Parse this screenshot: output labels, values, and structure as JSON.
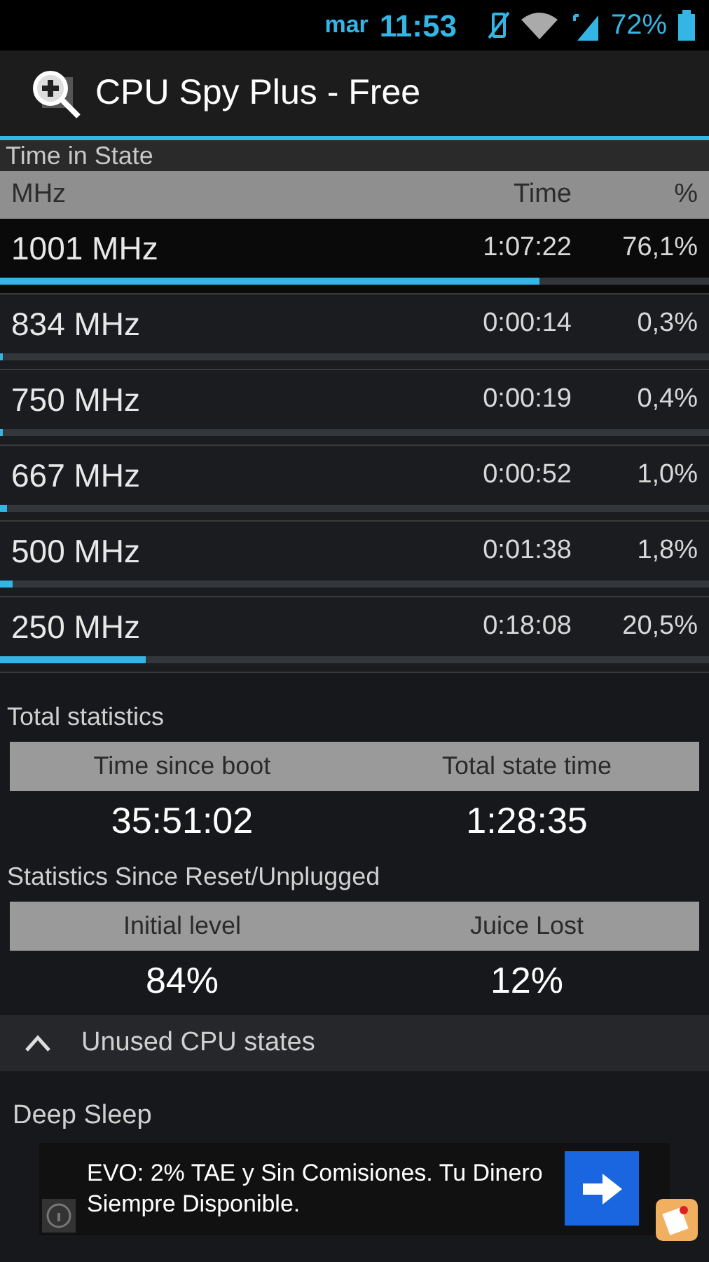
{
  "status_bar": {
    "day": "mar",
    "time": "11:53",
    "battery": "72%"
  },
  "action_bar": {
    "title": "CPU Spy Plus - Free"
  },
  "time_in_state": {
    "title": "Time in State",
    "columns": [
      "MHz",
      "Time",
      "%"
    ],
    "rows": [
      {
        "freq": "1001 MHz",
        "time": "1:07:22",
        "percent": "76,1%",
        "level": 0.761,
        "selected": true
      },
      {
        "freq": "834 MHz",
        "time": "0:00:14",
        "percent": "0,3%",
        "level": 0.003,
        "selected": false
      },
      {
        "freq": "750 MHz",
        "time": "0:00:19",
        "percent": "0,4%",
        "level": 0.004,
        "selected": false
      },
      {
        "freq": "667 MHz",
        "time": "0:00:52",
        "percent": "1,0%",
        "level": 0.01,
        "selected": false
      },
      {
        "freq": "500 MHz",
        "time": "0:01:38",
        "percent": "1,8%",
        "level": 0.018,
        "selected": false
      },
      {
        "freq": "250 MHz",
        "time": "0:18:08",
        "percent": "20,5%",
        "level": 0.205,
        "selected": false
      }
    ]
  },
  "total_statistics": {
    "title": "Total statistics",
    "labels": [
      "Time since boot",
      "Total state time"
    ],
    "values": [
      "35:51:02",
      "1:28:35"
    ]
  },
  "since_reset": {
    "title": "Statistics Since Reset/Unplugged",
    "labels": [
      "Initial level",
      "Juice Lost"
    ],
    "values": [
      "84%",
      "12%"
    ]
  },
  "unused_states": {
    "label": "Unused CPU states",
    "expanded": true
  },
  "deep_sleep": {
    "label": "Deep Sleep"
  },
  "ad": {
    "text": "EVO: 2% TAE y Sin Comisiones. Tu Dinero Siempre Disponible."
  }
}
